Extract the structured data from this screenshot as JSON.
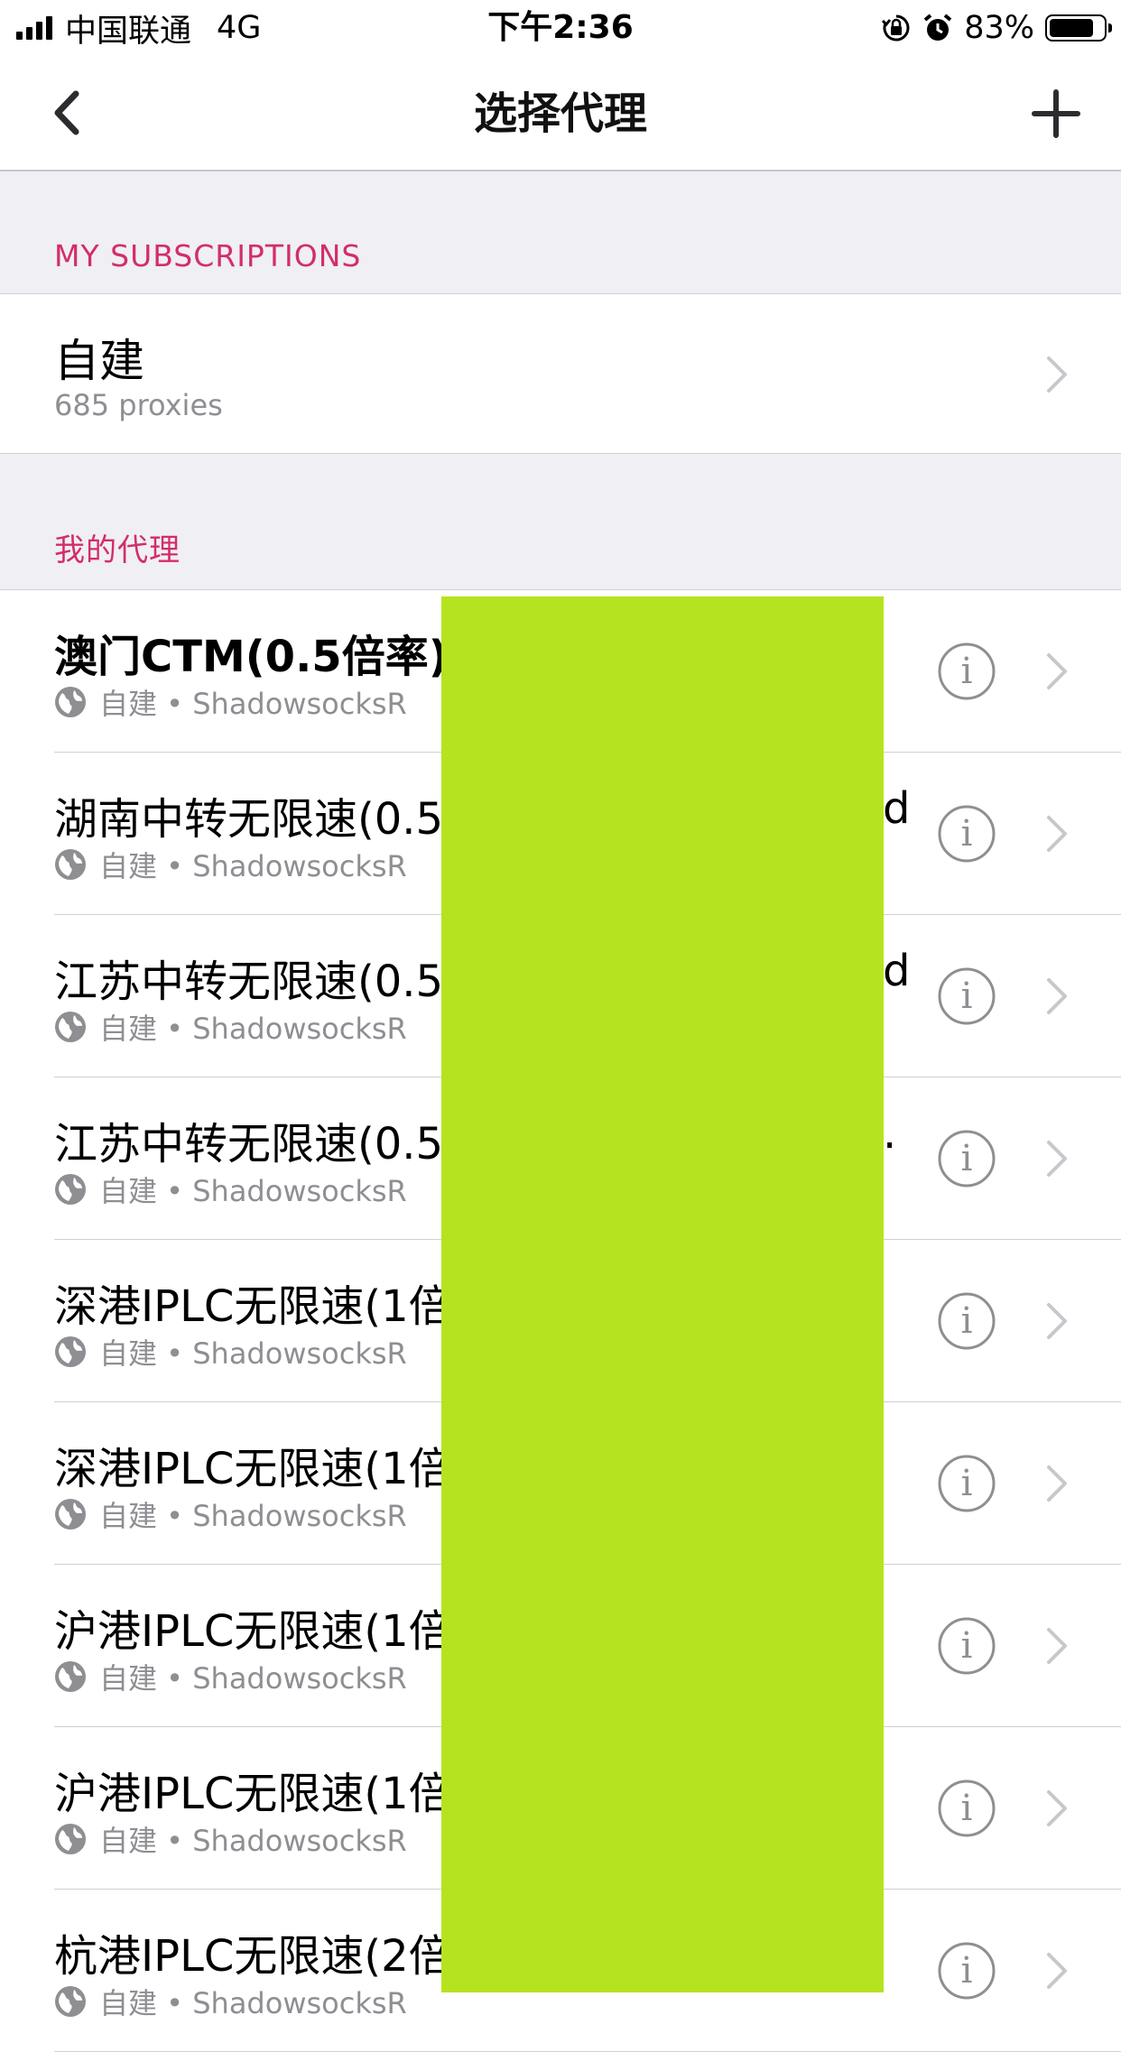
{
  "status_bar": {
    "carrier": "中国联通",
    "network": "4G",
    "time": "下午2:36",
    "battery_percent": "83%",
    "battery_level": 0.83,
    "icons": [
      "signal-icon",
      "orientation-lock-icon",
      "alarm-icon",
      "battery-icon"
    ]
  },
  "nav": {
    "title": "选择代理",
    "back_icon": "chevron-left-icon",
    "add_icon": "plus-icon"
  },
  "subscriptions": {
    "header": "MY SUBSCRIPTIONS",
    "item": {
      "name": "自建",
      "count": "685 proxies"
    }
  },
  "my_proxies": {
    "header": "我的代理",
    "items": [
      {
        "name": "澳门CTM(0.5倍率)",
        "meta": "自建 • ShadowsocksR",
        "suffix": ""
      },
      {
        "name": "湖南中转无限速(0.5",
        "meta": "自建 • ShadowsocksR",
        "suffix": "d"
      },
      {
        "name": "江苏中转无限速(0.5",
        "meta": "自建 • ShadowsocksR",
        "suffix": "d"
      },
      {
        "name": "江苏中转无限速(0.5",
        "meta": "自建 • ShadowsocksR",
        "suffix": "."
      },
      {
        "name": "深港IPLC无限速(1倍",
        "meta": "自建 • ShadowsocksR",
        "suffix": ""
      },
      {
        "name": "深港IPLC无限速(1倍",
        "meta": "自建 • ShadowsocksR",
        "suffix": ""
      },
      {
        "name": "沪港IPLC无限速(1倍",
        "meta": "自建 • ShadowsocksR",
        "suffix": ""
      },
      {
        "name": "沪港IPLC无限速(1倍",
        "meta": "自建 • ShadowsocksR",
        "suffix": ""
      },
      {
        "name": "杭港IPLC无限速(2倍",
        "meta": "自建 • ShadowsocksR",
        "suffix": ""
      }
    ]
  },
  "colors": {
    "accent": "#d32d6b",
    "group_background": "#efeff4",
    "separator": "#d0d0d5",
    "secondary_text": "#8e8e93",
    "redaction": "#b5e31f"
  }
}
